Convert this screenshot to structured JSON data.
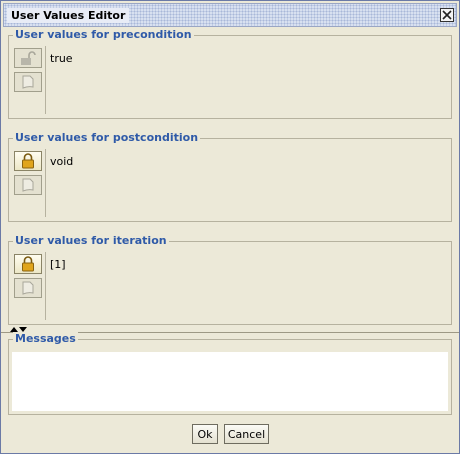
{
  "window": {
    "title": "User Values Editor",
    "close_icon": "close-icon"
  },
  "panels": [
    {
      "title": "User values for precondition",
      "value": "true",
      "lock_state": "unlocked",
      "buttons": [
        "unlock-icon",
        "document-icon"
      ]
    },
    {
      "title": "User values for postcondition",
      "value": "void",
      "lock_state": "locked",
      "buttons": [
        "lock-icon",
        "document-icon"
      ]
    },
    {
      "title": "User values for iteration",
      "value": "[1]",
      "lock_state": "locked",
      "buttons": [
        "lock-icon",
        "document-icon"
      ]
    }
  ],
  "messages": {
    "title": "Messages",
    "content": ""
  },
  "buttons": {
    "ok": "Ok",
    "cancel": "Cancel"
  },
  "colors": {
    "legend": "#2f5aa8",
    "background": "#ece9d8",
    "lock_gold": "#e0a51c"
  }
}
